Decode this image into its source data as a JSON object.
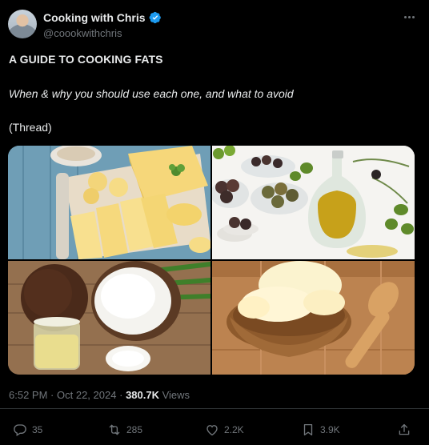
{
  "author": {
    "display_name": "Cooking with Chris",
    "handle": "@coookwithchris",
    "verified": true
  },
  "post": {
    "title": "A GUIDE TO COOKING FATS",
    "subtitle": "When & why you should use each one, and what to avoid",
    "thread_label": "(Thread)"
  },
  "media": {
    "images": [
      "butter-image",
      "olive-oil-image",
      "coconut-oil-image",
      "ghee-image"
    ]
  },
  "meta": {
    "time": "6:52 PM",
    "separator": "·",
    "date": "Oct 22, 2024",
    "views_count": "380.7K",
    "views_label": "Views"
  },
  "actions": {
    "replies": "35",
    "reposts": "285",
    "likes": "2.2K",
    "bookmarks": "3.9K"
  },
  "colors": {
    "background": "#000000",
    "text": "#e7e9ea",
    "muted": "#71767b",
    "verified": "#1d9bf0",
    "divider": "#2f3336"
  }
}
